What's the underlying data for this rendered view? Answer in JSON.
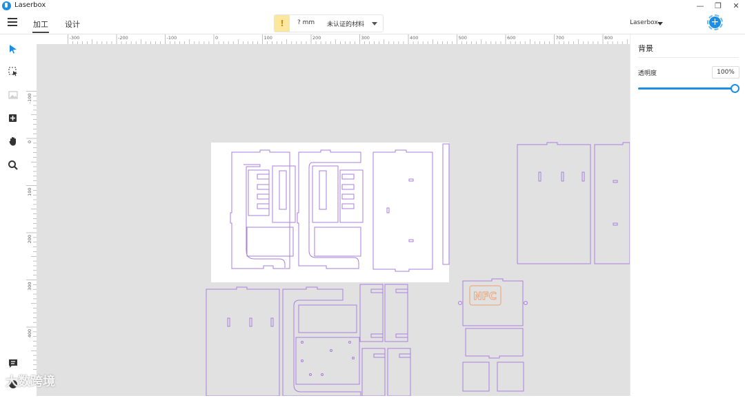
{
  "app": {
    "title": "Laserbox"
  },
  "window": {
    "minimize": "—",
    "restore": "❐",
    "close": "✕"
  },
  "tabs": [
    {
      "label": "加工",
      "active": true
    },
    {
      "label": "设计",
      "active": false
    }
  ],
  "material": {
    "warning": "!",
    "thickness": "? mm",
    "name": "未认证的材料"
  },
  "device": {
    "name": "Laserbox"
  },
  "ruler": {
    "h_labels": [
      "-300",
      "-200",
      "-100",
      "0",
      "100",
      "200",
      "300",
      "400",
      "500",
      "600",
      "700",
      "800"
    ],
    "v_labels": [
      "-100",
      "0",
      "100",
      "200",
      "300",
      "400"
    ]
  },
  "panel": {
    "title": "背景",
    "opacity_label": "透明度",
    "opacity_value": "100%",
    "opacity_level": 1.0
  },
  "canvas": {
    "nfc_text": "NFC"
  },
  "watermark": "大数跨境",
  "colors": {
    "accent": "#1a8fe3",
    "cut_line": "#a97ee0",
    "engrave": "#f0a070"
  }
}
